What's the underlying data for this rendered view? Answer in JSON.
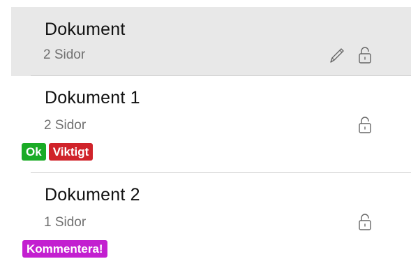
{
  "colors": {
    "selected_background": "#e8e8e8",
    "tag_ok": "#1aab25",
    "tag_important": "#d0232a",
    "tag_comment": "#c31fd0"
  },
  "documents": [
    {
      "title": "Dokument",
      "subtitle": "2 Sidor",
      "selected": true,
      "icons": [
        "pencil-icon",
        "lock-icon"
      ],
      "tags": []
    },
    {
      "title": "Dokument 1",
      "subtitle": "2 Sidor",
      "selected": false,
      "icons": [
        "lock-icon"
      ],
      "tags": [
        {
          "label": "Ok",
          "color": "#1aab25"
        },
        {
          "label": "Viktigt",
          "color": "#d0232a"
        }
      ]
    },
    {
      "title": "Dokument 2",
      "subtitle": "1 Sidor",
      "selected": false,
      "icons": [
        "lock-icon"
      ],
      "tags": [
        {
          "label": "Kommentera!",
          "color": "#c31fd0"
        }
      ]
    }
  ]
}
